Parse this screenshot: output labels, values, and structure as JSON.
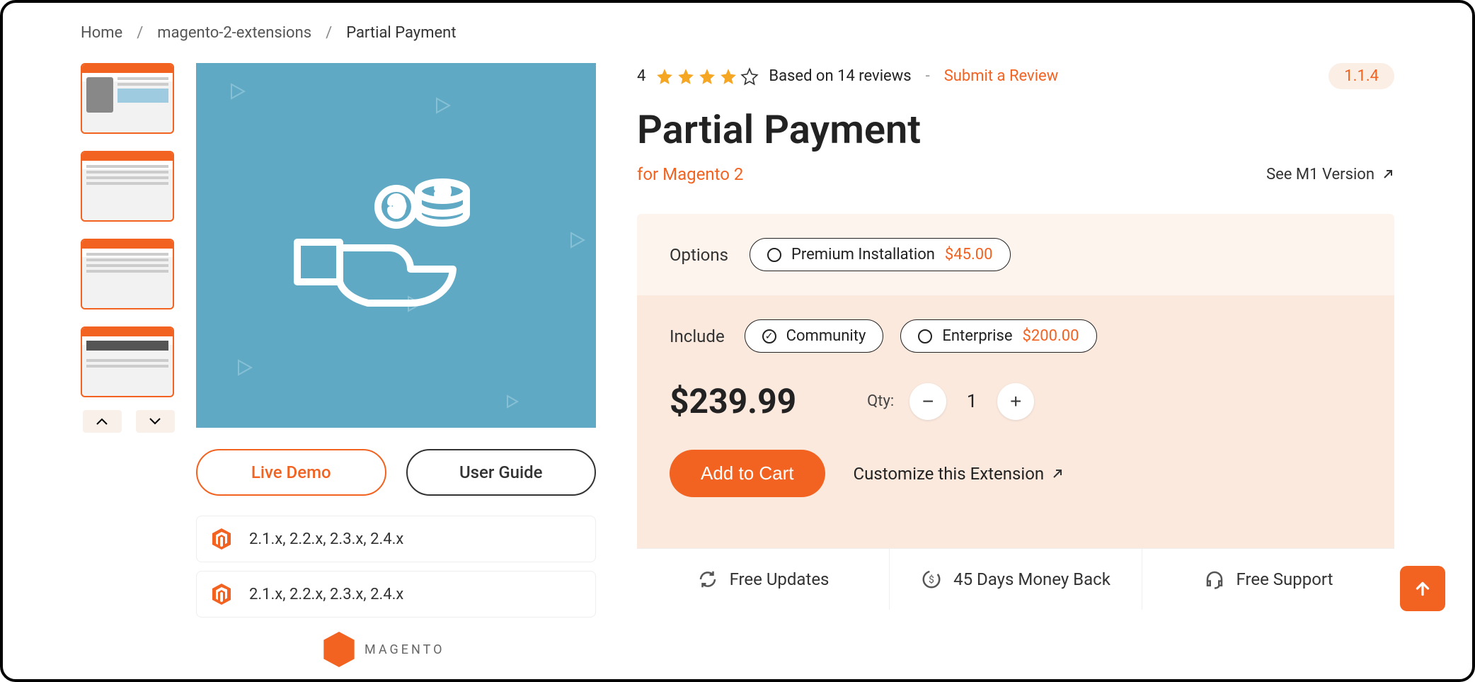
{
  "breadcrumb": {
    "home": "Home",
    "cat": "magento-2-extensions",
    "current": "Partial Payment"
  },
  "buttons": {
    "live_demo": "Live Demo",
    "user_guide": "User Guide"
  },
  "compat": {
    "line1": "2.1.x, 2.2.x, 2.3.x, 2.4.x",
    "line2": "2.1.x, 2.2.x, 2.3.x, 2.4.x"
  },
  "mlogo_text": "MAGENTO",
  "product": {
    "rating_value": "4",
    "reviews_text": "Based on 14 reviews",
    "submit_review": "Submit a Review",
    "version": "1.1.4",
    "title": "Partial Payment",
    "subtitle": "for Magento 2",
    "see_m1": "See M1 Version"
  },
  "options": {
    "label": "Options",
    "premium_label": "Premium Installation",
    "premium_price": "$45.00"
  },
  "include": {
    "label": "Include",
    "community": "Community",
    "enterprise": "Enterprise",
    "enterprise_price": "$200.00"
  },
  "purchase": {
    "price": "$239.99",
    "qty_label": "Qty:",
    "qty_value": "1",
    "add_to_cart": "Add to Cart",
    "customize": "Customize this Extension"
  },
  "features": {
    "free_updates": "Free Updates",
    "money_back": "45 Days Money Back",
    "free_support": "Free Support"
  }
}
